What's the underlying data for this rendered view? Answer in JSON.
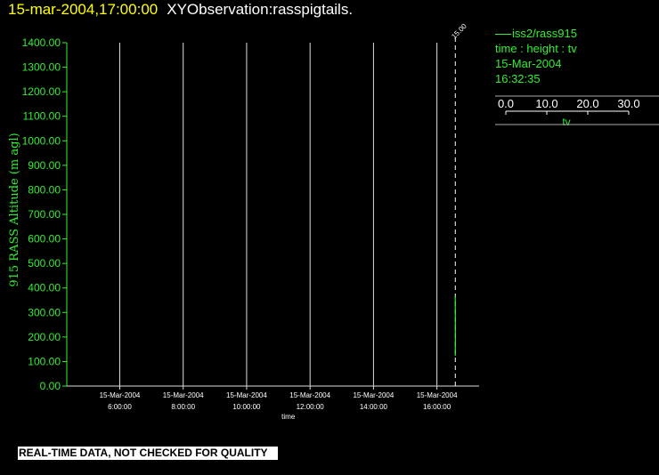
{
  "header": {
    "timestamp": "15-mar-2004,17:00:00",
    "name": "XYObservation:rasspigtails."
  },
  "footer": {
    "notice": "REAL-TIME DATA, NOT CHECKED FOR QUALITY"
  },
  "legend": {
    "station": "iss2/rass915",
    "fields": "time : height : tv",
    "date": "15-Mar-2004",
    "time": "16:32:35",
    "axis_label": "tv",
    "axis_ticks": [
      "0.0",
      "10.0",
      "20.0",
      "30.0"
    ]
  },
  "colors": {
    "background": "#000000",
    "axis_green": "#33ee33",
    "grid": "#dddddd",
    "title_yellow": "#ffff00"
  },
  "chart_data": {
    "type": "line",
    "ylabel": "915 RASS Altitude (m agl)",
    "xlabel": "time",
    "ylim": [
      0,
      1400
    ],
    "yticks": [
      "1400.00",
      "1300.00",
      "1200.00",
      "1100.00",
      "1000.00",
      "900.00",
      "800.00",
      "700.00",
      "600.00",
      "500.00",
      "400.00",
      "300.00",
      "200.00",
      "100.00",
      "0.00"
    ],
    "xlim_hours": [
      4.33,
      17.33
    ],
    "xticks": [
      {
        "hour": 6,
        "date": "15-Mar-2004",
        "time": "6:00:00"
      },
      {
        "hour": 8,
        "date": "15-Mar-2004",
        "time": "8:00:00"
      },
      {
        "hour": 10,
        "date": "15-Mar-2004",
        "time": "10:00:00"
      },
      {
        "hour": 12,
        "date": "15-Mar-2004",
        "time": "12:00:00"
      },
      {
        "hour": 14,
        "date": "15-Mar-2004",
        "time": "14:00:00"
      },
      {
        "hour": 16,
        "date": "15-Mar-2004",
        "time": "16:00:00"
      }
    ],
    "marker": {
      "hour": 16.58,
      "label": "15.00"
    },
    "series": [
      {
        "color": "#33ee33",
        "tv_origin_hour": 16.58,
        "tv_scale_hours_per_unit": 0.003,
        "points": [
          {
            "height": 365,
            "tv": -1.2
          },
          {
            "height": 330,
            "tv": -0.6
          },
          {
            "height": 300,
            "tv": 0.0
          },
          {
            "height": 250,
            "tv": 0.4
          },
          {
            "height": 200,
            "tv": 0.6
          },
          {
            "height": 160,
            "tv": 0.2
          },
          {
            "height": 125,
            "tv": -0.6
          }
        ]
      }
    ]
  }
}
